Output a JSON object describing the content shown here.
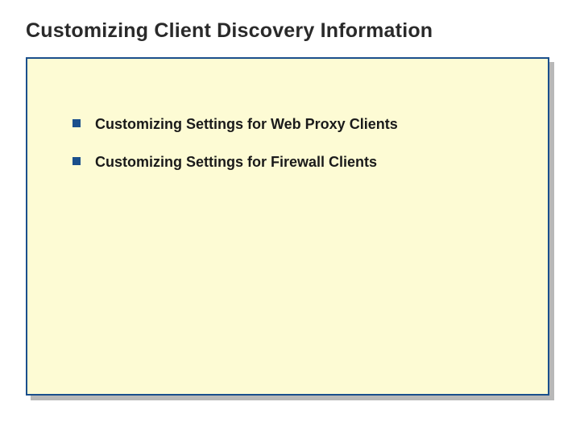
{
  "slide": {
    "title": "Customizing Client Discovery Information",
    "bullets": [
      {
        "text": "Customizing Settings for Web Proxy Clients"
      },
      {
        "text": "Customizing Settings for Firewall Clients"
      }
    ]
  },
  "colors": {
    "border": "#1a4f8c",
    "background": "#fdfbd4",
    "bullet": "#1a4f8c"
  }
}
